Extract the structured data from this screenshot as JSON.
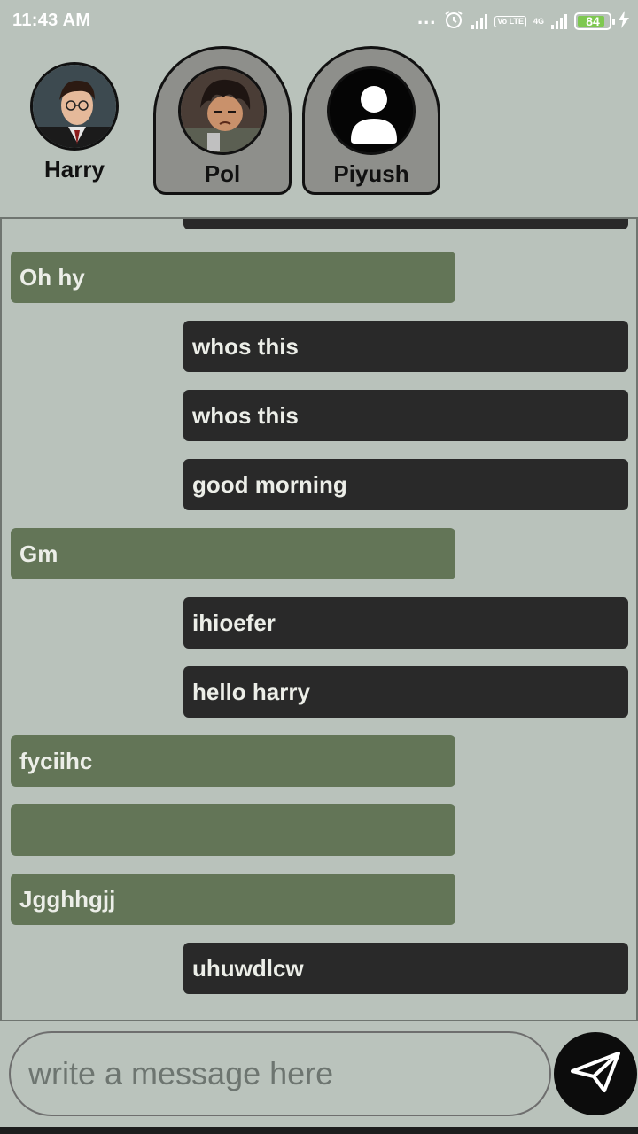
{
  "status_bar": {
    "time": "11:43 AM",
    "dots": "...",
    "volte": "Vo LTE",
    "network": "4G",
    "battery": "84"
  },
  "contacts": [
    {
      "name": "Harry",
      "selected": false
    },
    {
      "name": "Pol",
      "selected": true
    },
    {
      "name": "Piyush",
      "selected": true
    }
  ],
  "messages": [
    {
      "direction": "out",
      "text": ""
    },
    {
      "direction": "in",
      "text": "Oh hy"
    },
    {
      "direction": "out",
      "text": "whos this"
    },
    {
      "direction": "out",
      "text": "whos this"
    },
    {
      "direction": "out",
      "text": "good morning"
    },
    {
      "direction": "in",
      "text": "Gm"
    },
    {
      "direction": "out",
      "text": "ihioefer"
    },
    {
      "direction": "out",
      "text": "hello harry"
    },
    {
      "direction": "in",
      "text": "fyciihc"
    },
    {
      "direction": "in",
      "text": ""
    },
    {
      "direction": "in",
      "text": "Jgghhgjj"
    },
    {
      "direction": "out",
      "text": "uhuwdlcw"
    }
  ],
  "composer": {
    "placeholder": "write a message here"
  },
  "icons": {
    "send": "send-icon",
    "alarm": "alarm-icon",
    "charging": "lightning-icon"
  },
  "colors": {
    "background": "#b9c2bb",
    "incoming_bubble": "#637557",
    "outgoing_bubble": "#292929"
  }
}
